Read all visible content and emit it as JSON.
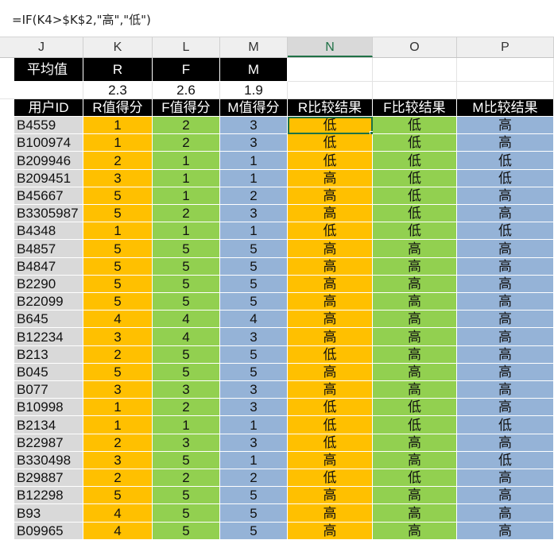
{
  "formula": "=IF(K4>$K$2,\"高\",\"低\")",
  "columns": [
    "J",
    "K",
    "L",
    "M",
    "N",
    "O",
    "P"
  ],
  "active_column": "N",
  "summary": {
    "label": "平均值",
    "headers": [
      "R",
      "F",
      "M"
    ],
    "values": [
      "2.3",
      "2.6",
      "1.9"
    ]
  },
  "table_headers": [
    "用户ID",
    "R值得分",
    "F值得分",
    "M值得分",
    "R比较结果",
    "F比较结果",
    "M比较结果"
  ],
  "colors": {
    "gray": "#d9d9d9",
    "orange": "#ffc000",
    "green": "#92d050",
    "blue": "#95b3d7",
    "black": "#000000",
    "selection": "#1e7145"
  },
  "rows": [
    [
      "B4559",
      "1",
      "2",
      "3",
      "低",
      "低",
      "高"
    ],
    [
      "B100974",
      "1",
      "2",
      "3",
      "低",
      "低",
      "高"
    ],
    [
      "B209946",
      "2",
      "1",
      "1",
      "低",
      "低",
      "低"
    ],
    [
      "B209451",
      "3",
      "1",
      "1",
      "高",
      "低",
      "低"
    ],
    [
      "B45667",
      "5",
      "1",
      "2",
      "高",
      "低",
      "高"
    ],
    [
      "B3305987",
      "5",
      "2",
      "3",
      "高",
      "低",
      "高"
    ],
    [
      "B4348",
      "1",
      "1",
      "1",
      "低",
      "低",
      "低"
    ],
    [
      "B4857",
      "5",
      "5",
      "5",
      "高",
      "高",
      "高"
    ],
    [
      "B4847",
      "5",
      "5",
      "5",
      "高",
      "高",
      "高"
    ],
    [
      "B2290",
      "5",
      "5",
      "5",
      "高",
      "高",
      "高"
    ],
    [
      "B22099",
      "5",
      "5",
      "5",
      "高",
      "高",
      "高"
    ],
    [
      "B645",
      "4",
      "4",
      "4",
      "高",
      "高",
      "高"
    ],
    [
      "B12234",
      "3",
      "4",
      "3",
      "高",
      "高",
      "高"
    ],
    [
      "B213",
      "2",
      "5",
      "5",
      "低",
      "高",
      "高"
    ],
    [
      "B045",
      "5",
      "5",
      "5",
      "高",
      "高",
      "高"
    ],
    [
      "B077",
      "3",
      "3",
      "3",
      "高",
      "高",
      "高"
    ],
    [
      "B10998",
      "1",
      "2",
      "3",
      "低",
      "低",
      "高"
    ],
    [
      "B2134",
      "1",
      "1",
      "1",
      "低",
      "低",
      "低"
    ],
    [
      "B22987",
      "2",
      "3",
      "3",
      "低",
      "高",
      "高"
    ],
    [
      "B330498",
      "3",
      "5",
      "1",
      "高",
      "高",
      "低"
    ],
    [
      "B29887",
      "2",
      "2",
      "2",
      "低",
      "低",
      "高"
    ],
    [
      "B12298",
      "5",
      "5",
      "5",
      "高",
      "高",
      "高"
    ],
    [
      "B93",
      "4",
      "5",
      "5",
      "高",
      "高",
      "高"
    ],
    [
      "B09965",
      "4",
      "5",
      "5",
      "高",
      "高",
      "高"
    ]
  ]
}
